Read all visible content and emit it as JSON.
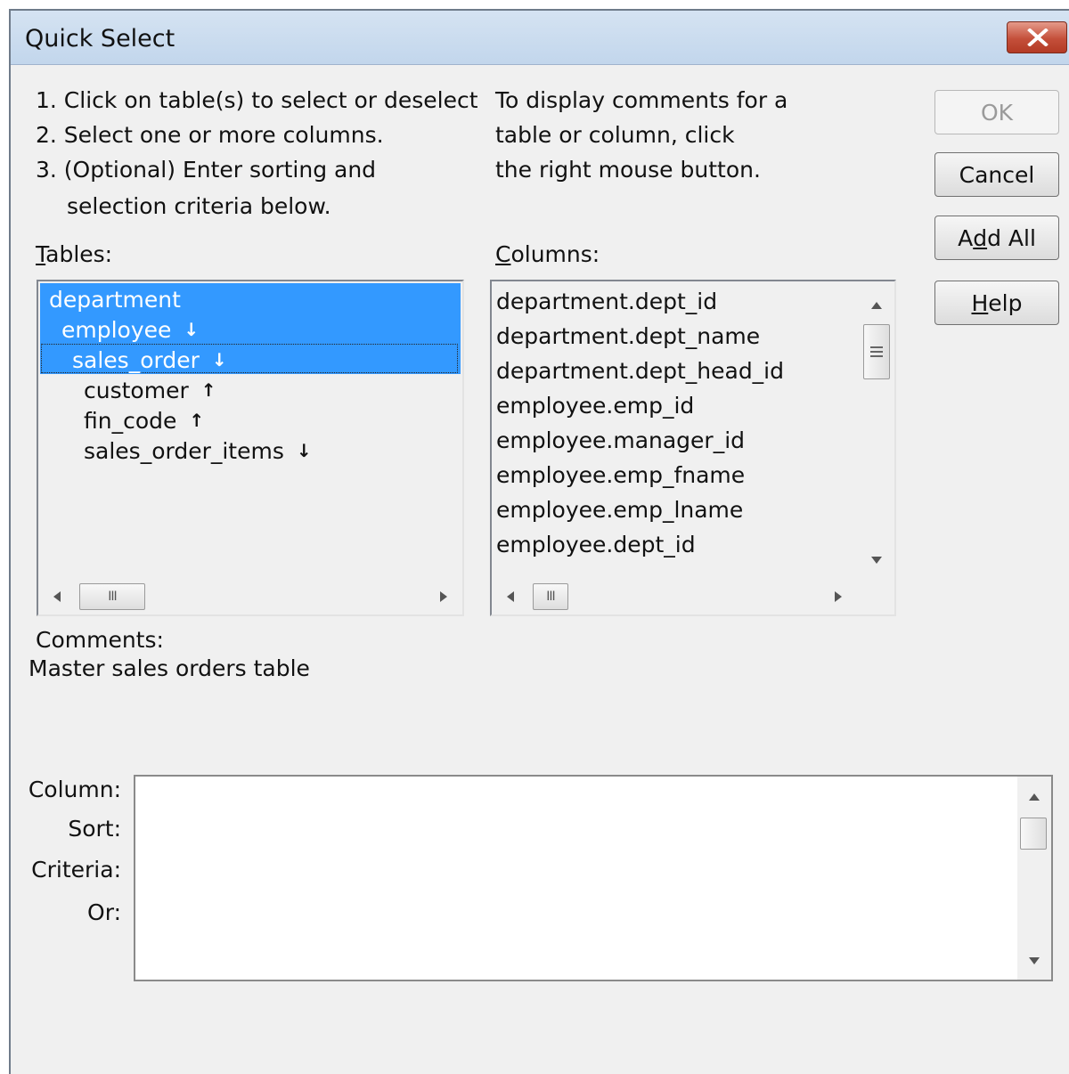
{
  "window": {
    "title": "Quick Select"
  },
  "instructions": {
    "left": [
      "1. Click on table(s) to select or deselect",
      "2. Select one or more columns.",
      "3. (Optional) Enter sorting and",
      "selection criteria below."
    ],
    "right": [
      "To display comments for a",
      "table or column, click",
      "the right mouse button."
    ]
  },
  "buttons": {
    "ok": "OK",
    "cancel": "Cancel",
    "add_all_pre": "A",
    "add_all_ul": "d",
    "add_all_post": "d All",
    "help_ul": "H",
    "help_post": "elp"
  },
  "tables": {
    "label_ul": "T",
    "label_post": "ables:",
    "items": [
      {
        "name": "department",
        "selected": true,
        "arrow": ""
      },
      {
        "name": "employee",
        "selected": true,
        "arrow": "down"
      },
      {
        "name": "sales_order",
        "selected": true,
        "arrow": "down"
      },
      {
        "name": "customer",
        "selected": false,
        "arrow": "up"
      },
      {
        "name": "fin_code",
        "selected": false,
        "arrow": "up"
      },
      {
        "name": "sales_order_items",
        "selected": false,
        "arrow": "down"
      }
    ]
  },
  "columns": {
    "label_ul": "C",
    "label_post": "olumns:",
    "items": [
      "department.dept_id",
      "department.dept_name",
      "department.dept_head_id",
      "employee.emp_id",
      "employee.manager_id",
      "employee.emp_fname",
      "employee.emp_lname",
      "employee.dept_id"
    ]
  },
  "comments": {
    "label": "Comments:",
    "text": "Master sales orders table"
  },
  "grid": {
    "labels": [
      "Column:",
      "Sort:",
      "Criteria:",
      "Or:"
    ]
  },
  "icons": {
    "close": "close-icon",
    "arrow_up": "↑",
    "arrow_down": "↓",
    "grip": "III"
  },
  "colors": {
    "selection": "#3399ff",
    "title_bar": "#c8daee",
    "close": "#c44f3a"
  }
}
